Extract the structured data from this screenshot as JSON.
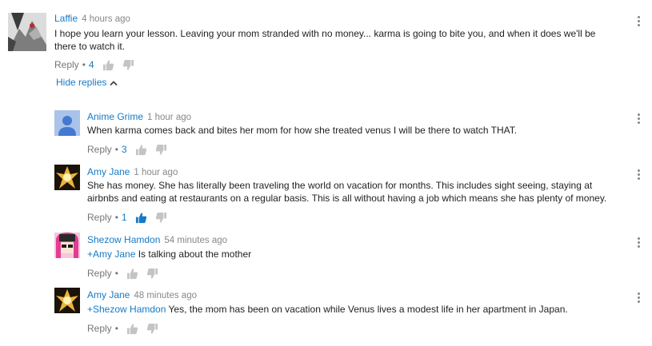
{
  "main_comment": {
    "author": "Laffie",
    "time": "4 hours ago",
    "text": "I hope you learn your lesson. Leaving your mom stranded with no money... karma is going to bite you, and when it does we'll be there to watch it.",
    "reply_label": "Reply",
    "like_count": "4"
  },
  "hide_replies_label": "Hide replies",
  "replies": [
    {
      "author": "Anime Grime",
      "time": "1 hour ago",
      "mention": "",
      "text": "When karma comes back and bites her mom for how she treated venus I will be there to watch THAT.",
      "reply_label": "Reply",
      "like_count": "3"
    },
    {
      "author": "Amy Jane",
      "time": "1 hour ago",
      "mention": "",
      "text": "She has money. She has literally been traveling the world on vacation for months. This includes sight seeing, staying at airbnbs and eating at restaurants on a regular basis. This is all without having a job which means she has plenty of money.",
      "reply_label": "Reply",
      "like_count": "1"
    },
    {
      "author": "Shezow Hamdon",
      "time": "54 minutes ago",
      "mention": "+Amy Jane",
      "text": "Is talking about the mother",
      "reply_label": "Reply",
      "like_count": ""
    },
    {
      "author": "Amy Jane",
      "time": "48 minutes ago",
      "mention": "+Shezow Hamdon",
      "text": "Yes, the mom has been on vacation while Venus lives a modest life in her apartment in Japan.",
      "reply_label": "Reply",
      "like_count": ""
    }
  ],
  "colors": {
    "link_blue": "#167ac6",
    "muted_gray": "#767676",
    "liked_blue": "#167ac6"
  },
  "icons": [
    "thumbs-up-icon",
    "thumbs-down-icon",
    "more-vert-icon",
    "chevron-up-icon",
    "avatar"
  ]
}
